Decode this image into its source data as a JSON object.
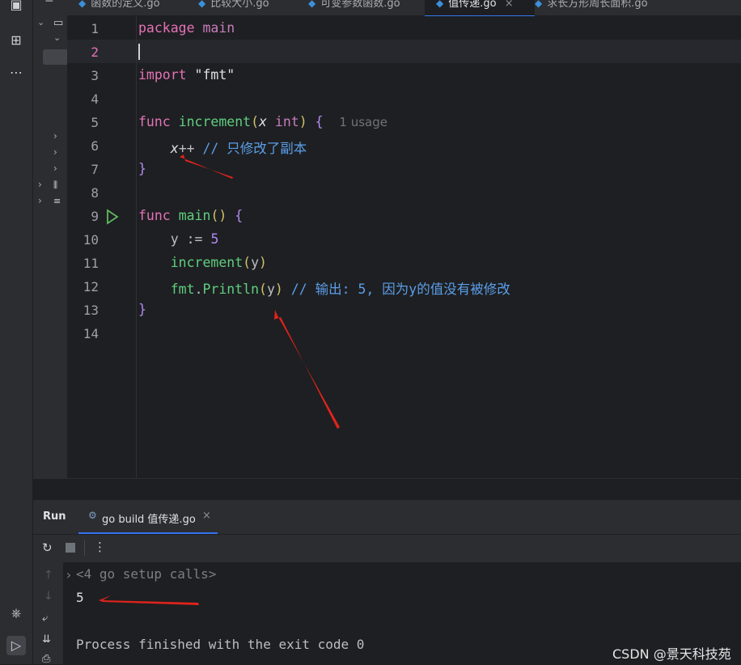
{
  "tabs": [
    {
      "label": "函数的定义.go"
    },
    {
      "label": "比较大小.go"
    },
    {
      "label": "可变参数函数.go"
    },
    {
      "label": "值传递.go",
      "close": "×"
    },
    {
      "label": "求长方形周长面积.go"
    }
  ],
  "editor": {
    "line_numbers": [
      "1",
      "2",
      "3",
      "4",
      "5",
      "6",
      "7",
      "8",
      "9",
      "10",
      "11",
      "12",
      "13",
      "14"
    ],
    "code": {
      "l1_kw": "package",
      "l1_name": "main",
      "l3_kw": "import",
      "l3_str": "\"fmt\"",
      "l5_kw": "func",
      "l5_fn": "increment",
      "l5_param": "x",
      "l5_type": "int",
      "l5_hint": "1 usage",
      "l6_var": "x",
      "l6_op": "++",
      "l6_comment": "// 只修改了副本",
      "l9_kw": "func",
      "l9_fn": "main",
      "l10_var": "y",
      "l10_op": ":=",
      "l10_num": "5",
      "l11_fn": "increment",
      "l11_arg": "y",
      "l12_pkg": "fmt",
      "l12_fn": "Println",
      "l12_arg": "y",
      "l12_comment": "// 输出: 5, 因为y的值没有被修改"
    }
  },
  "run_panel": {
    "title": "Run",
    "tab_label": "go build 值传递.go",
    "tab_close": "×",
    "console_lines": [
      "<4 go setup calls>",
      "5",
      "Process finished with the exit code 0"
    ]
  },
  "watermark": "CSDN @景天科技苑",
  "colors": {
    "arrow": "#e0231b",
    "accent": "#3574f0",
    "line2_number": "#e472b6"
  }
}
